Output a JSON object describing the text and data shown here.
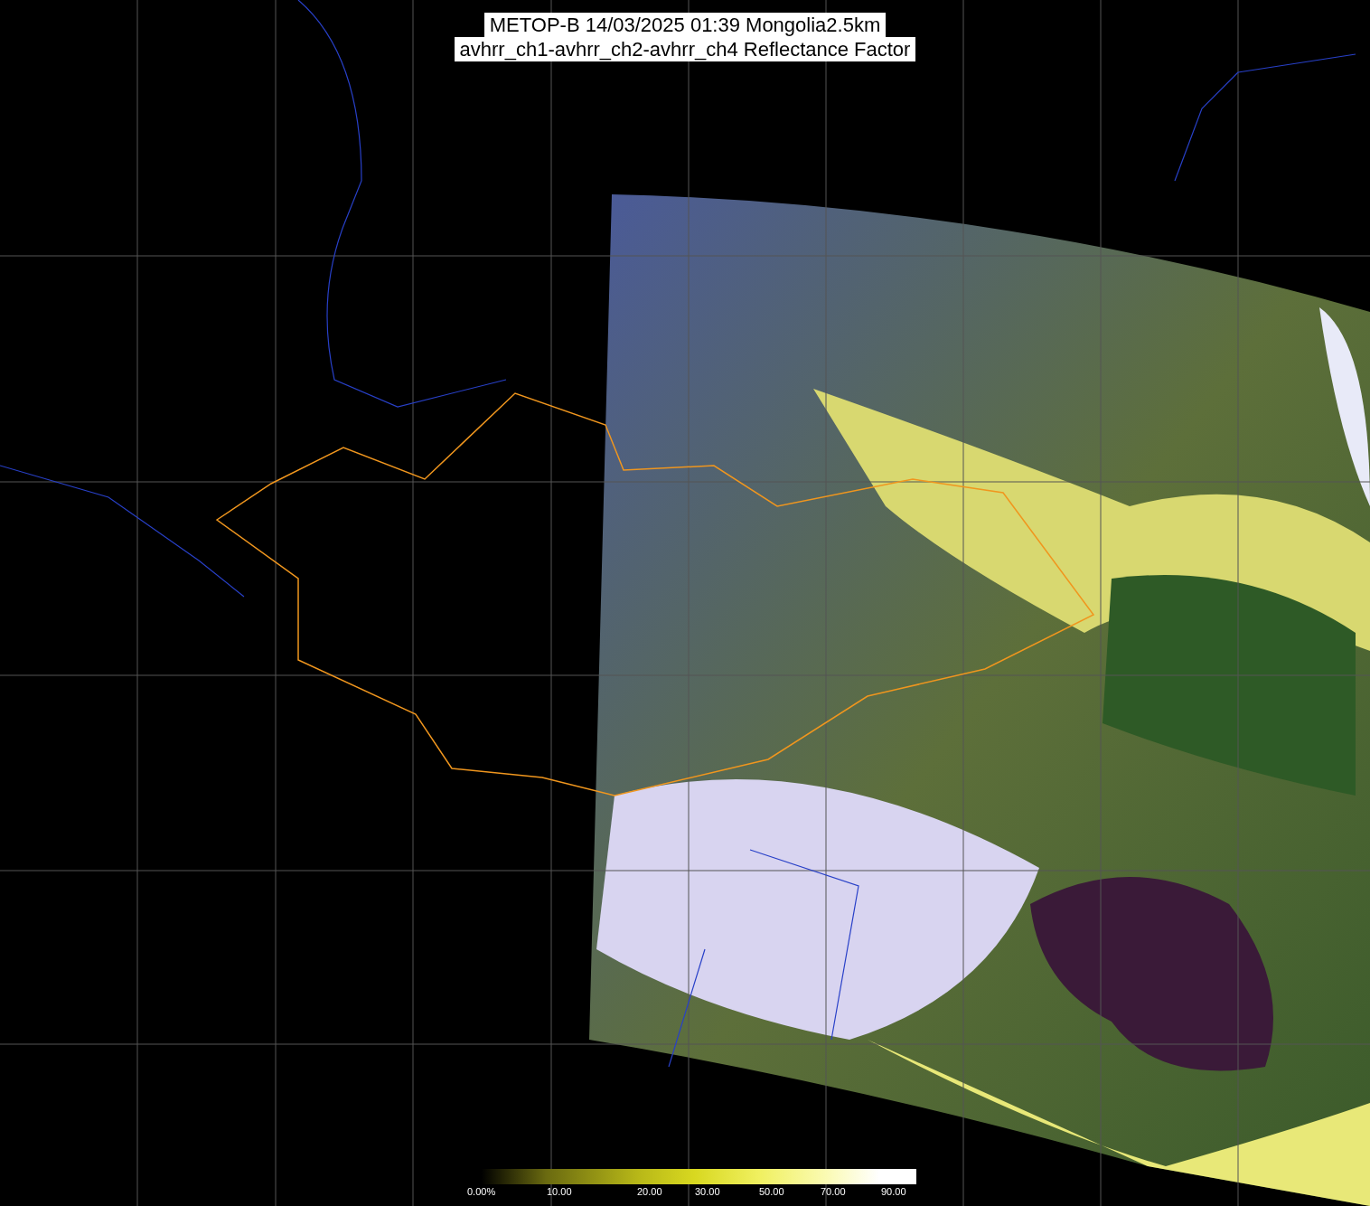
{
  "title": {
    "lines": [
      "METOP-B 14/03/2025 01:39 Mongolia2.5km",
      "avhrr_ch1-avhrr_ch2-avhrr_ch4 Reflectance Factor"
    ]
  },
  "colorbar": {
    "labels": [
      "0.00%",
      "10.00",
      "20.00",
      "30.00",
      "50.00",
      "70.00",
      "90.00"
    ]
  }
}
